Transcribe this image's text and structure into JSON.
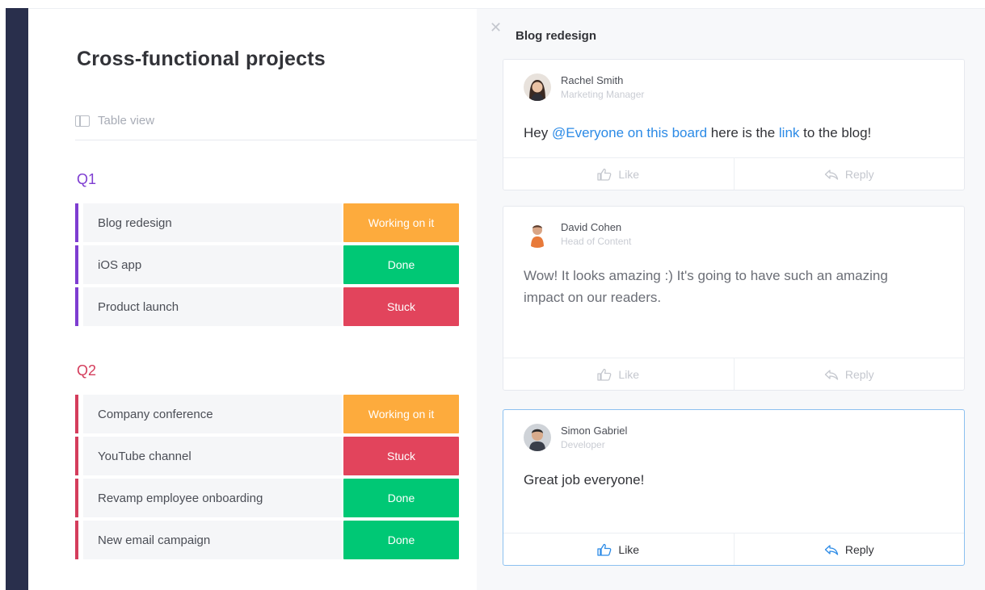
{
  "board": {
    "title": "Cross-functional projects",
    "view_label": "Table view",
    "groups": [
      {
        "title": "Q1",
        "color": "#7e3dd1",
        "items": [
          {
            "name": "Blog redesign",
            "status": "Working on it",
            "status_color": "#fdab3d",
            "has_updates": true
          },
          {
            "name": "iOS app",
            "status": "Done",
            "status_color": "#00c875",
            "has_updates": true
          },
          {
            "name": "Product launch",
            "status": "Stuck",
            "status_color": "#e2445c",
            "has_updates": false
          }
        ]
      },
      {
        "title": "Q2",
        "color": "#d43d5c",
        "items": [
          {
            "name": "Company conference",
            "status": "Working on it",
            "status_color": "#fdab3d",
            "has_updates": false
          },
          {
            "name": "YouTube channel",
            "status": "Stuck",
            "status_color": "#e2445c",
            "has_updates": false
          },
          {
            "name": "Revamp employee onboarding",
            "status": "Done",
            "status_color": "#00c875",
            "has_updates": false
          },
          {
            "name": "New email campaign",
            "status": "Done",
            "status_color": "#00c875",
            "has_updates": false
          }
        ]
      }
    ]
  },
  "panel": {
    "close_icon": "close-icon",
    "title": "Blog redesign",
    "updates": [
      {
        "author": "Rachel Smith",
        "role": "Marketing Manager",
        "message_parts": [
          "Hey ",
          "@Everyone on this board",
          " here is the ",
          "link",
          " to the blog!"
        ],
        "like_label": "Like",
        "reply_label": "Reply"
      },
      {
        "author": "David Cohen",
        "role": "Head of Content",
        "message_lines": [
          "Wow! It looks amazing :) It's going to have such an amazing",
          "impact on our readers."
        ],
        "like_label": "Like",
        "reply_label": "Reply"
      },
      {
        "author": "Simon Gabriel",
        "role": "Developer",
        "message": "Great job everyone!",
        "like_label": "Like",
        "reply_label": "Reply"
      }
    ]
  }
}
